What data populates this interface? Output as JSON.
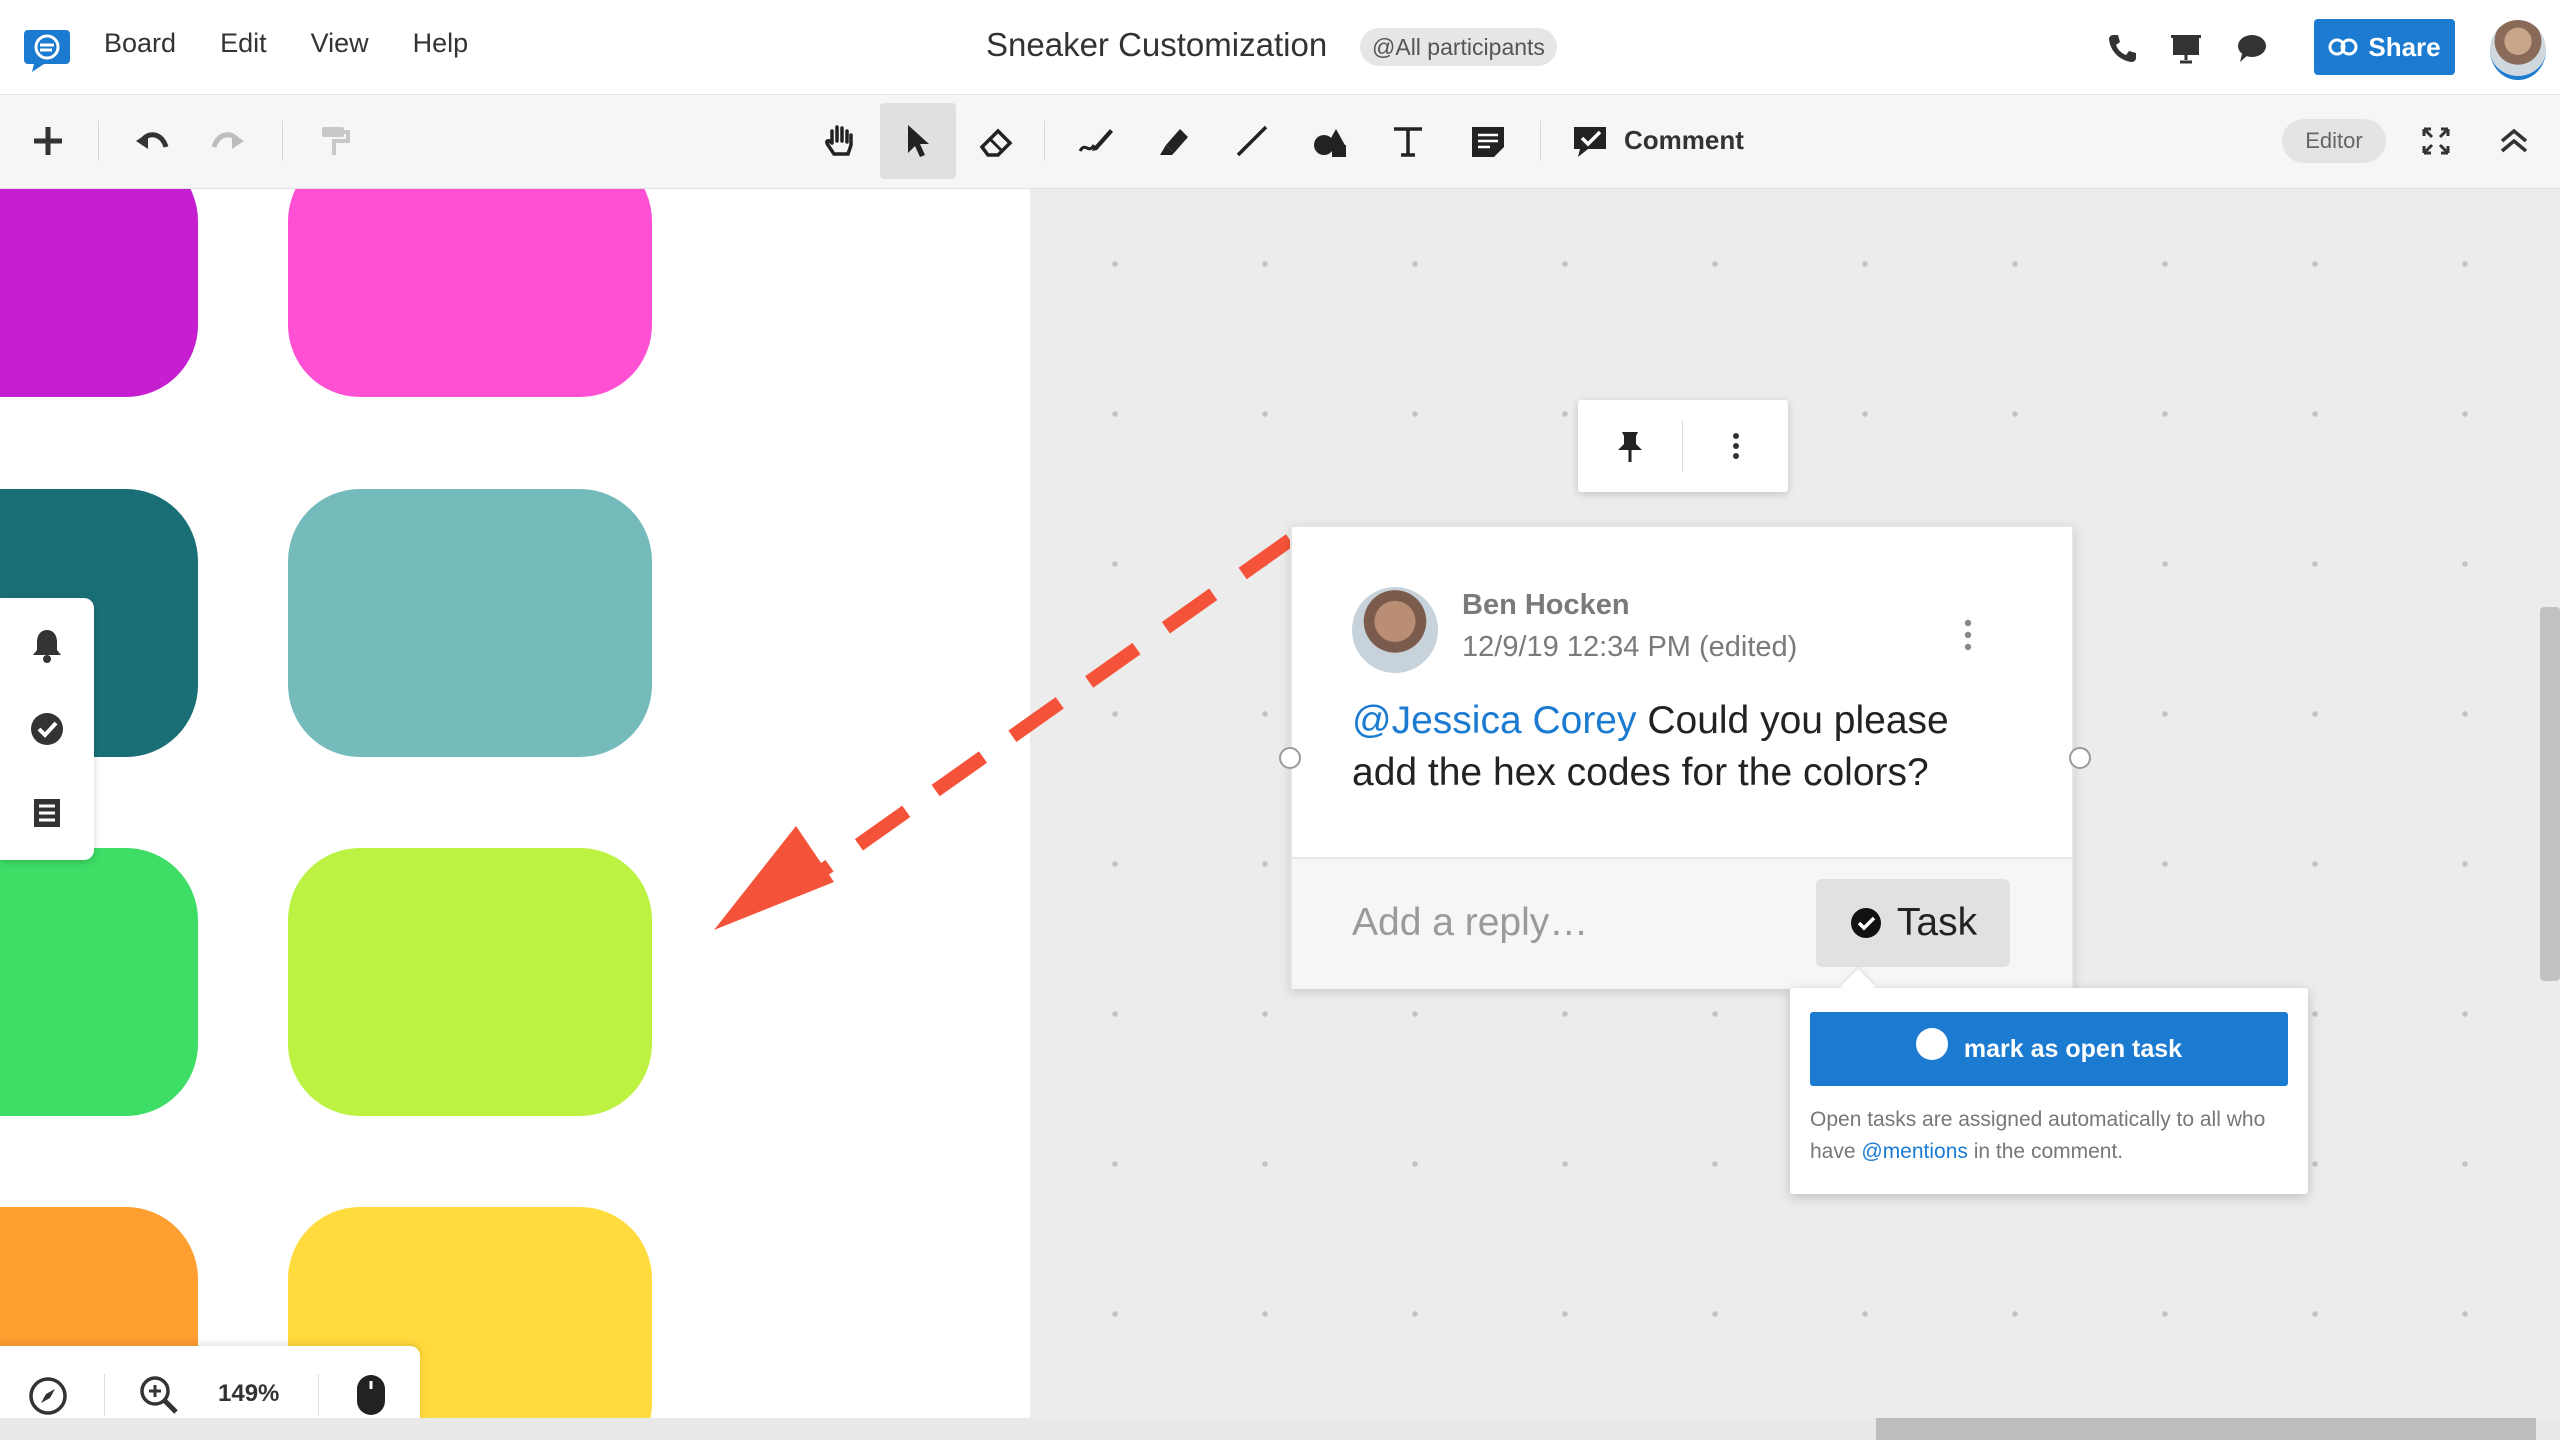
{
  "menu": {
    "items": [
      "Board",
      "Edit",
      "View",
      "Help"
    ],
    "title": "Sneaker Customization",
    "participants": "@All participants"
  },
  "header": {
    "share_label": "Share"
  },
  "toolbar": {
    "comment_label": "Comment",
    "mode_label": "Editor"
  },
  "comment": {
    "author": "Ben Hocken",
    "timestamp": "12/9/19 12:34 PM (edited)",
    "mention": "@Jessica Corey",
    "text": " Could you please add the hex codes for the colors?",
    "reply_placeholder": "Add a reply…",
    "task_label": "Task"
  },
  "task_popup": {
    "button_label": "mark as open task",
    "note_before": "Open tasks are assigned automatically to all who have ",
    "note_link": "@mentions",
    "note_after": " in the comment."
  },
  "zoom": {
    "level": "149%"
  },
  "colors": {
    "accent": "#1b7bd1",
    "arrow": "#f55339",
    "swatches": [
      "#c61fcf",
      "#ff4fd2",
      "#1a6f77",
      "#76bbbb",
      "#3ddd66",
      "#bcf242",
      "#ff9e31",
      "#ffdb3d"
    ]
  }
}
